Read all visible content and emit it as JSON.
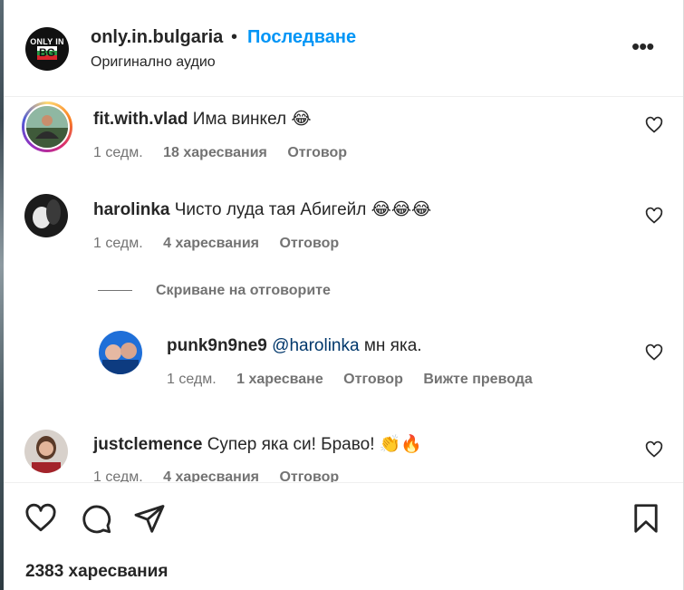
{
  "header": {
    "logo_line1": "ONLY IN",
    "logo_line2": "BG",
    "username": "only.in.bulgaria",
    "dot": "•",
    "follow_label": "Последване",
    "audio_label": "Оригинално аудио",
    "more_glyph": "•••"
  },
  "comments": [
    {
      "username": "fit.with.vlad",
      "text": "Има винкел",
      "emoji": "😂",
      "time": "1 седм.",
      "likes": "18 харесвания",
      "reply_label": "Отговор"
    },
    {
      "username": "harolinka",
      "text": "Чисто луда тая Абигейл",
      "emoji": "😂😂😂",
      "time": "1 седм.",
      "likes": "4 харесвания",
      "reply_label": "Отговор",
      "hide_replies_label": "Скриване на отговорите"
    },
    {
      "username": "punk9n9ne9",
      "mention": "@harolinka",
      "text": "мн яка.",
      "time": "1 седм.",
      "likes": "1 харесване",
      "reply_label": "Отговор",
      "translate_label": "Вижте превода"
    },
    {
      "username": "justclemence",
      "text": "Супер яка си! Браво!",
      "emoji": "👏🔥",
      "time": "1 седм.",
      "likes": "4 харесвания",
      "reply_label": "Отговор"
    }
  ],
  "actions": {
    "like_icon": "heart-icon",
    "comment_icon": "comment-icon",
    "share_icon": "share-icon",
    "save_icon": "bookmark-icon",
    "likes_count": "2383 харесвания"
  },
  "colors": {
    "accent": "#0095f6",
    "text": "#262626",
    "muted": "#737373",
    "mention": "#00376b"
  }
}
